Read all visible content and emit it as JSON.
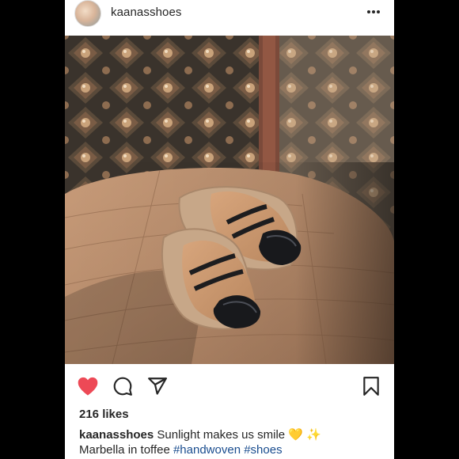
{
  "post": {
    "username": "kaanasshoes",
    "more_icon": "more-horizontal-icon",
    "photo_alt": "Woven espadrille mules on wooden table",
    "actions": {
      "like_icon": "heart-filled-icon",
      "comment_icon": "comment-icon",
      "share_icon": "paper-plane-icon",
      "save_icon": "bookmark-icon",
      "like_color": "#ed4956"
    },
    "likes": "216 likes",
    "caption": {
      "user": "kaanasshoes",
      "text1": " Sunlight makes us smile 💛 ✨",
      "text2": "Marbella in toffee ",
      "tag1": "#handwoven",
      "tag2": "#shoes"
    }
  }
}
